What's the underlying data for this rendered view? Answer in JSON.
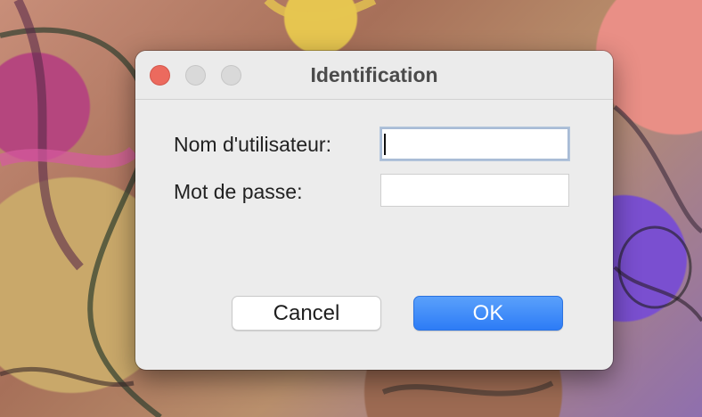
{
  "dialog": {
    "title": "Identification",
    "window_controls": [
      "close",
      "minimize",
      "maximize"
    ]
  },
  "form": {
    "username_label": "Nom d'utilisateur:",
    "username_value": "",
    "password_label": "Mot de passe:",
    "password_value": ""
  },
  "buttons": {
    "cancel_label": "Cancel",
    "ok_label": "OK"
  },
  "colors": {
    "accent": "#2d7cf6",
    "close_button": "#ec6a5e",
    "dialog_background": "#ececec"
  }
}
